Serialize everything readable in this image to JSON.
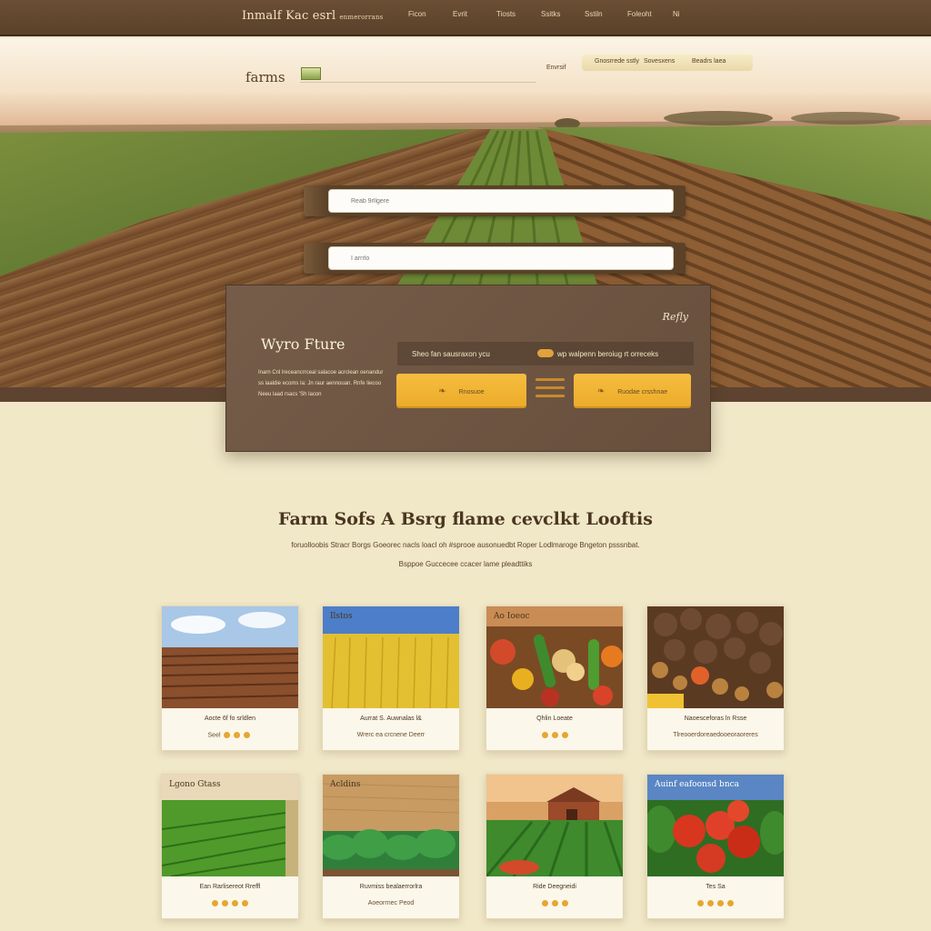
{
  "topbar": {
    "brand": "Inmalf Kac esrl",
    "brand_tagline": "enmerorrans",
    "nav": [
      "Ficon",
      "Evrit",
      "Tiosts",
      "Ssitks",
      "Sstiln",
      "Foleoht",
      "Ni"
    ]
  },
  "subheader": {
    "logo": "farms",
    "plain_link": "Envrsif",
    "pill_links": [
      "Gnosrrede sstly",
      "Sovesxens",
      "Beadrs laea"
    ]
  },
  "search": {
    "primary_placeholder": "Reab 9rllgere",
    "secondary_placeholder": "I arrrlo"
  },
  "feature": {
    "tag": "Refly",
    "title": "Wyro Fture",
    "description": "Inarn Cnl lreceancrrceal salacoe acrclean oenandur ss laaldie ecoms Ia: Jn raur aennouan. Rnfe Iiecoo Neeu laad rsacs 'Sh lacon",
    "prompt_left": "Sheo fan sausraxon ycu",
    "prompt_right": "wp walpenn beroiug rt orreceks",
    "cta_primary": "Rnosuoe",
    "cta_secondary": "Ruodae crsshnae"
  },
  "section": {
    "title": "Farm Sofs A Bsrg flame cevclkt Looftis",
    "sub_line1": "foruolloobis Stracr Borgs Goeorec nacls loacl oh #sprooe ausonuedbt Roper Lodlmaroge Bngeton psssnbat.",
    "sub_line2": "Bsppoe Guccecee ccacer lame pleadttiks"
  },
  "cards": [
    {
      "label": "",
      "caption": "Aocte 6f fo srldlen",
      "meta": "Seel"
    },
    {
      "label": "Ilstos",
      "caption": "Aurrat S. Auwnalas l&",
      "meta": "Wrerc ea crcnene Deerr"
    },
    {
      "label": "Ao Ioeoc",
      "caption": "Qhlin Loeate",
      "meta": ""
    },
    {
      "label": "",
      "caption": "Naoesceforas ln Rsse",
      "meta": "Tlreooerdoreaedooeoraoreres"
    },
    {
      "label": "Lgono Gtass",
      "caption": "Ean Rarlisereot Rreffl",
      "meta": ""
    },
    {
      "label": "Acldins",
      "caption": "Ruvmiss bealaerrorlra",
      "meta": "Aoeorrnec Peod"
    },
    {
      "label": "",
      "caption": "Ride Deegneidi",
      "meta": ""
    },
    {
      "label": "Auinf eafoonsd bnca",
      "caption": "Tes Sa",
      "meta": ""
    }
  ],
  "colors": {
    "topbar": "#5a412a",
    "page_bg": "#f1e8c8",
    "accent": "#f2b53a",
    "card_bg": "#fbf7ea",
    "feature_bg": "#6e5440"
  }
}
